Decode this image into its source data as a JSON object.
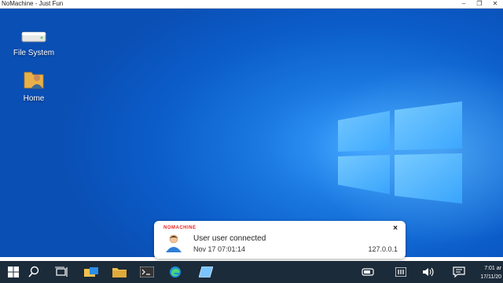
{
  "window": {
    "title": "NoMachine - Just Fun",
    "controls": [
      "–",
      "❐",
      "✕"
    ]
  },
  "desktop": {
    "icons": [
      {
        "label": "File System",
        "icon": "drive-icon"
      },
      {
        "label": "Home",
        "icon": "home-folder-icon"
      }
    ]
  },
  "notification": {
    "brand": "NOMACHINE",
    "message": "User user connected",
    "time": "Nov 17 07:01:14",
    "ip": "127.0.0.1",
    "close": "×"
  },
  "taskbar": {
    "items": [
      "start-icon",
      "search-icon",
      "task-view-icon",
      "file-explorer-icon",
      "folder-icon",
      "terminal-icon",
      "edge-icon",
      "app-icon"
    ],
    "tray": [
      "network-icon",
      "nomachine-tray-icon",
      "volume-icon",
      "notifications-icon"
    ],
    "clock_time": "7:01 ar",
    "clock_date": "17/11/20"
  }
}
